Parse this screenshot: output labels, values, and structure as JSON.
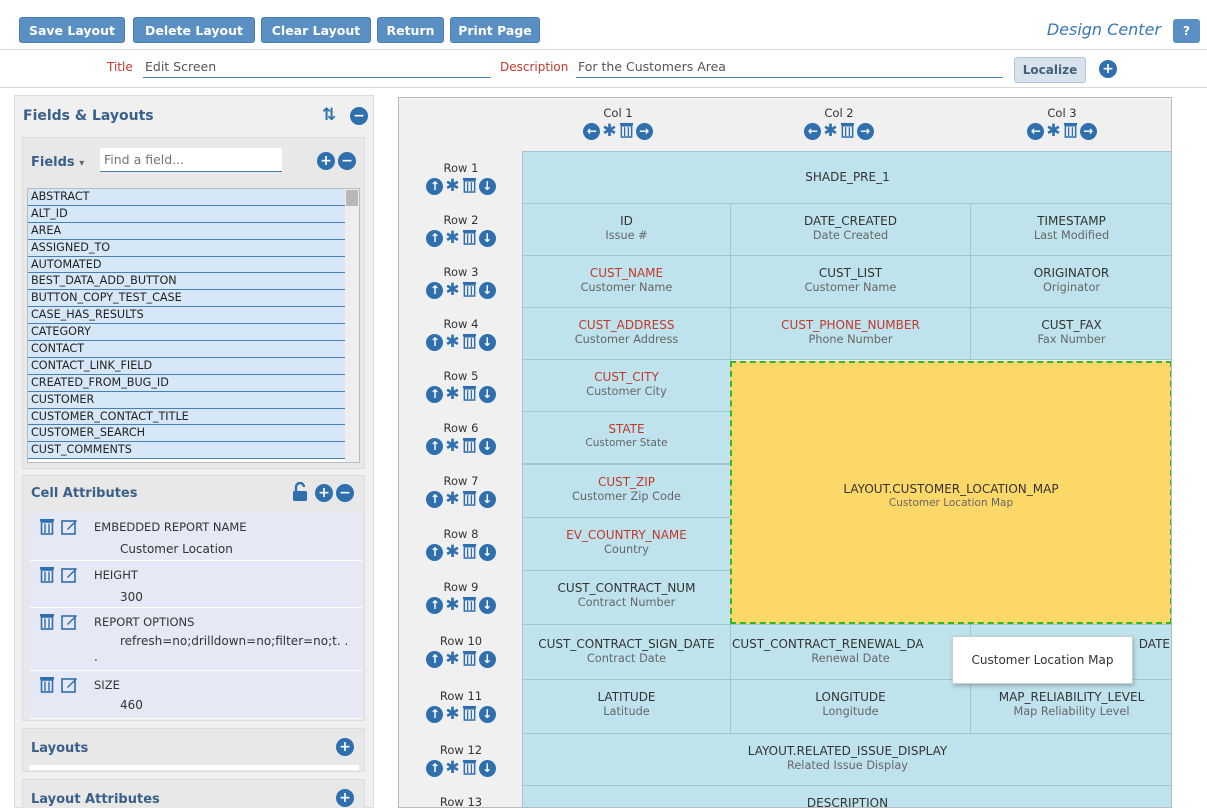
{
  "toolbar": {
    "save": "Save Layout",
    "delete": "Delete Layout",
    "clear": "Clear Layout",
    "return": "Return",
    "print": "Print Page",
    "design_center": "Design Center",
    "help": "?"
  },
  "header": {
    "title_label": "Title",
    "title_value": "Edit Screen",
    "description_label": "Description",
    "description_value": "For the Customers Area",
    "localize": "Localize"
  },
  "sidebar": {
    "heading": "Fields & Layouts",
    "fields_label": "Fields",
    "fields_dropdown_glyph": "▾",
    "search_placeholder": "Find a field...",
    "fields": [
      "ABSTRACT",
      "ALT_ID",
      "AREA",
      "ASSIGNED_TO",
      "AUTOMATED",
      "BEST_DATA_ADD_BUTTON",
      "BUTTON_COPY_TEST_CASE",
      "CASE_HAS_RESULTS",
      "CATEGORY",
      "CONTACT",
      "CONTACT_LINK_FIELD",
      "CREATED_FROM_BUG_ID",
      "CUSTOMER",
      "CUSTOMER_CONTACT_TITLE",
      "CUSTOMER_SEARCH",
      "CUST_COMMENTS"
    ],
    "cell_attributes_heading": "Cell Attributes",
    "attributes": [
      {
        "name": "EMBEDDED REPORT NAME",
        "value": "Customer Location"
      },
      {
        "name": "HEIGHT",
        "value": "300"
      },
      {
        "name": "REPORT OPTIONS",
        "value": "refresh=no;drilldown=no;filter=no;t. .",
        "value_cont": "."
      },
      {
        "name": "SIZE",
        "value": "460"
      }
    ],
    "layouts_heading": "Layouts",
    "layout_attributes_heading": "Layout Attributes"
  },
  "grid": {
    "columns": [
      "Col 1",
      "Col 2",
      "Col 3"
    ],
    "rows": [
      "Row 1",
      "Row 2",
      "Row 3",
      "Row 4",
      "Row 5",
      "Row 6",
      "Row 7",
      "Row 8",
      "Row 9",
      "Row 10",
      "Row 11",
      "Row 12",
      "Row 13"
    ],
    "cells": {
      "r1": {
        "name": "SHADE_PRE_1",
        "label": ""
      },
      "r2c1": {
        "name": "ID",
        "label": "Issue #"
      },
      "r2c2": {
        "name": "DATE_CREATED",
        "label": "Date Created"
      },
      "r2c3": {
        "name": "TIMESTAMP",
        "label": "Last Modified"
      },
      "r3c1": {
        "name": "CUST_NAME",
        "label": "Customer Name"
      },
      "r3c2": {
        "name": "CUST_LIST",
        "label": "Customer Name"
      },
      "r3c3": {
        "name": "ORIGINATOR",
        "label": "Originator"
      },
      "r4c1": {
        "name": "CUST_ADDRESS",
        "label": "Customer Address"
      },
      "r4c2": {
        "name": "CUST_PHONE_NUMBER",
        "label": "Phone Number"
      },
      "r4c3": {
        "name": "CUST_FAX",
        "label": "Fax Number"
      },
      "r5c1": {
        "name": "CUST_CITY",
        "label": "Customer City"
      },
      "r6c1": {
        "name": "STATE",
        "label": "Customer State"
      },
      "r7c1": {
        "name": "CUST_ZIP",
        "label": "Customer Zip Code"
      },
      "r8c1": {
        "name": "EV_COUNTRY_NAME",
        "label": "Country"
      },
      "r9c1": {
        "name": "CUST_CONTRACT_NUM",
        "label": "Contract Number"
      },
      "map": {
        "name": "LAYOUT.CUSTOMER_LOCATION_MAP",
        "label": "Customer Location Map"
      },
      "r10c1": {
        "name": "CUST_CONTRACT_SIGN_DATE",
        "label": "Contract Date"
      },
      "r10c2": {
        "name": "CUST_CONTRACT_RENEWAL_DA",
        "label": "Renewal Date"
      },
      "r10c3": {
        "name": "DATE",
        "label": ""
      },
      "r11c1": {
        "name": "LATITUDE",
        "label": "Latitude"
      },
      "r11c2": {
        "name": "LONGITUDE",
        "label": "Longitude"
      },
      "r11c3": {
        "name": "MAP_RELIABILITY_LEVEL",
        "label": "Map Reliability Level"
      },
      "r12": {
        "name": "LAYOUT.RELATED_ISSUE_DISPLAY",
        "label": "Related Issue Display"
      },
      "r13": {
        "name": "DESCRIPTION",
        "label": ""
      }
    },
    "tooltip": "Customer Location Map"
  },
  "colors": {
    "accent": "#5a8fc4",
    "cell": "#bfe3ec",
    "selected": "#fcd868",
    "required": "#c0392b"
  }
}
